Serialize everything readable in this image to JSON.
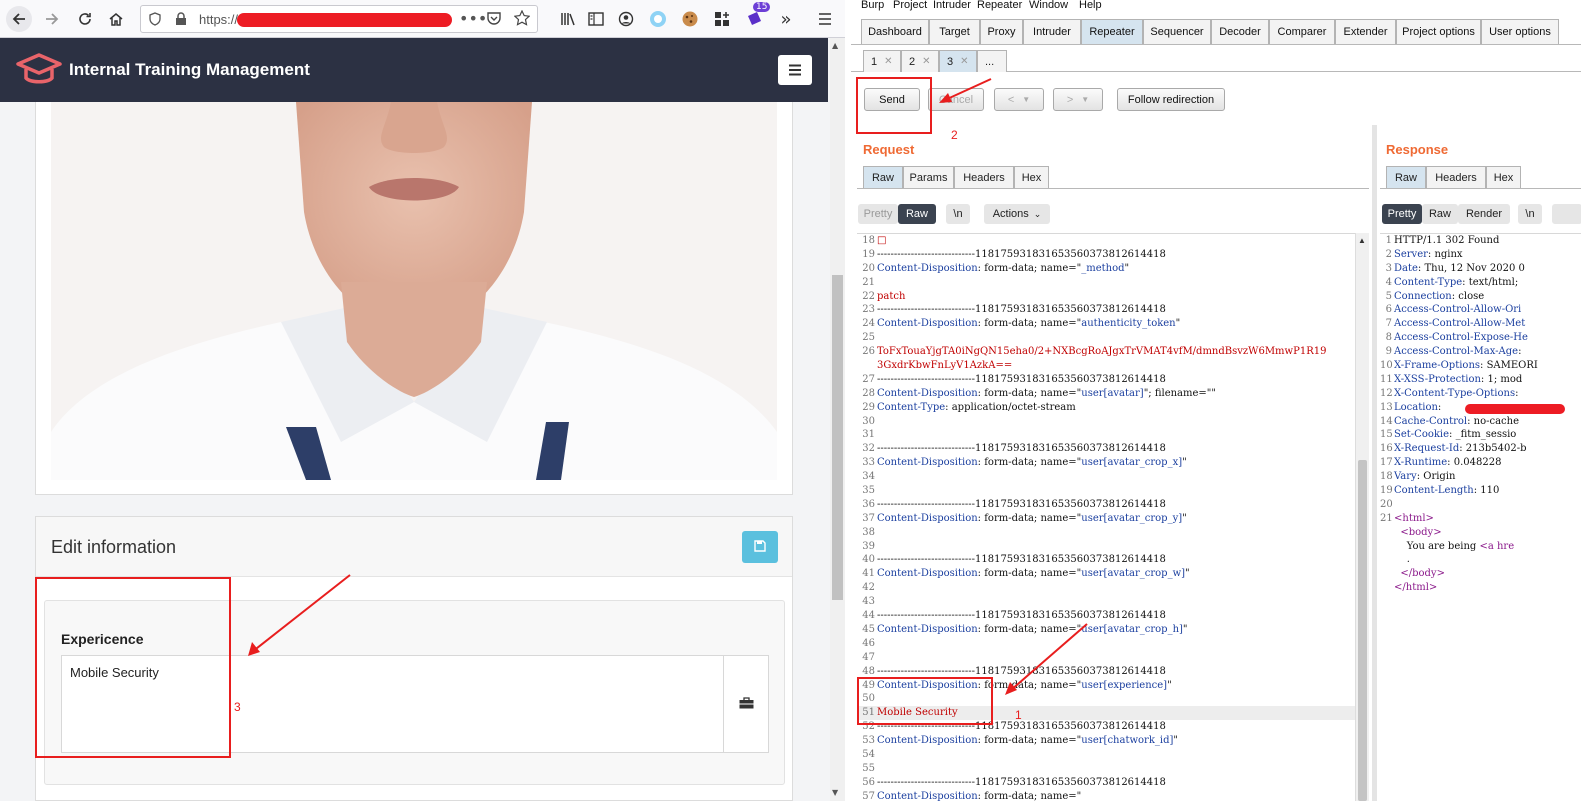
{
  "browser": {
    "url_prefix": "https://",
    "extension_badge": "15"
  },
  "app": {
    "brand": "Internal Training Management"
  },
  "edit": {
    "title": "Edit information",
    "experience_label": "Expericence",
    "experience_value": "Mobile Security"
  },
  "burp": {
    "menu": [
      "Burp",
      "Project",
      "Intruder",
      "Repeater",
      "Window",
      "Help"
    ],
    "tabs": [
      "Dashboard",
      "Target",
      "Proxy",
      "Intruder",
      "Repeater",
      "Sequencer",
      "Decoder",
      "Comparer",
      "Extender",
      "Project options",
      "User options"
    ],
    "active_tab": "Repeater",
    "subtabs": [
      "1",
      "2",
      "3",
      "..."
    ],
    "buttons": {
      "send": "Send",
      "cancel": "Cancel",
      "back": "<",
      "forward": ">",
      "follow": "Follow redirection"
    },
    "request": {
      "title": "Request",
      "tabs": [
        "Raw",
        "Params",
        "Headers",
        "Hex"
      ],
      "view_buttons": [
        "Pretty",
        "Raw",
        "\\n",
        "Actions"
      ]
    },
    "response": {
      "title": "Response",
      "tabs": [
        "Raw",
        "Headers",
        "Hex"
      ],
      "view_buttons": [
        "Pretty",
        "Raw",
        "Render",
        "\\n"
      ]
    }
  },
  "request_lines": [
    {
      "n": "18",
      "text": "□",
      "cls": "r"
    },
    {
      "n": "19",
      "text": "-----------------------------118175931831653560373812614418"
    },
    {
      "n": "20",
      "key": "Content-Disposition",
      "rest": ": form-data; name=\"",
      "val": "_method",
      "end": "\""
    },
    {
      "n": "21",
      "text": ""
    },
    {
      "n": "22",
      "text": "patch",
      "cls": "r"
    },
    {
      "n": "23",
      "text": "-----------------------------118175931831653560373812614418"
    },
    {
      "n": "24",
      "key": "Content-Disposition",
      "rest": ": form-data; name=\"",
      "val": "authenticity_token",
      "end": "\""
    },
    {
      "n": "25",
      "text": ""
    },
    {
      "n": "26",
      "text": "ToFxTouaYjgTA0iNgQN15eha0/2+NXBcgRoAJgxTrVMAT4vfM/dmndBsvzW6MmwP1R19",
      "cls": "r"
    },
    {
      "n": "",
      "text": "3GxdrKbwFnLyV1AzkA==",
      "cls": "r"
    },
    {
      "n": "27",
      "text": "-----------------------------118175931831653560373812614418"
    },
    {
      "n": "28",
      "key": "Content-Disposition",
      "rest": ": form-data; name=\"",
      "val": "user[avatar]",
      "end": "\"; filename=\"\""
    },
    {
      "n": "29",
      "key": "Content-Type",
      "rest": ": application/octet-stream",
      "val": "",
      "end": ""
    },
    {
      "n": "30",
      "text": ""
    },
    {
      "n": "31",
      "text": ""
    },
    {
      "n": "32",
      "text": "-----------------------------118175931831653560373812614418"
    },
    {
      "n": "33",
      "key": "Content-Disposition",
      "rest": ": form-data; name=\"",
      "val": "user[avatar_crop_x]",
      "end": "\""
    },
    {
      "n": "34",
      "text": ""
    },
    {
      "n": "35",
      "text": ""
    },
    {
      "n": "36",
      "text": "-----------------------------118175931831653560373812614418"
    },
    {
      "n": "37",
      "key": "Content-Disposition",
      "rest": ": form-data; name=\"",
      "val": "user[avatar_crop_y]",
      "end": "\""
    },
    {
      "n": "38",
      "text": ""
    },
    {
      "n": "39",
      "text": ""
    },
    {
      "n": "40",
      "text": "-----------------------------118175931831653560373812614418"
    },
    {
      "n": "41",
      "key": "Content-Disposition",
      "rest": ": form-data; name=\"",
      "val": "user[avatar_crop_w]",
      "end": "\""
    },
    {
      "n": "42",
      "text": ""
    },
    {
      "n": "43",
      "text": ""
    },
    {
      "n": "44",
      "text": "-----------------------------118175931831653560373812614418"
    },
    {
      "n": "45",
      "key": "Content-Disposition",
      "rest": ": form-data; name=\"",
      "val": "user[avatar_crop_h]",
      "end": "\""
    },
    {
      "n": "46",
      "text": ""
    },
    {
      "n": "47",
      "text": ""
    },
    {
      "n": "48",
      "text": "-----------------------------118175931831653560373812614418"
    },
    {
      "n": "49",
      "key": "Content-Disposition",
      "rest": ": form-data; name=\"",
      "val": "user[experience]",
      "end": "\""
    },
    {
      "n": "50",
      "text": ""
    },
    {
      "n": "51",
      "text": "Mobile Security",
      "cls": "r",
      "hl": true
    },
    {
      "n": "52",
      "text": "-----------------------------118175931831653560373812614418"
    },
    {
      "n": "53",
      "key": "Content-Disposition",
      "rest": ": form-data; name=\"",
      "val": "user[chatwork_id]",
      "end": "\""
    },
    {
      "n": "54",
      "text": ""
    },
    {
      "n": "55",
      "text": ""
    },
    {
      "n": "56",
      "text": "-----------------------------118175931831653560373812614418"
    },
    {
      "n": "57",
      "key": "Content-Disposition",
      "rest": ": form-data; name=\"",
      "val": "",
      "end": ""
    }
  ],
  "response_lines": [
    {
      "n": "1",
      "text": "HTTP/1.1 302 Found"
    },
    {
      "n": "2",
      "key": "Server",
      "rest": ": nginx"
    },
    {
      "n": "3",
      "key": "Date",
      "rest": ": Thu, 12 Nov 2020 0"
    },
    {
      "n": "4",
      "key": "Content-Type",
      "rest": ": text/html;"
    },
    {
      "n": "5",
      "key": "Connection",
      "rest": ": close"
    },
    {
      "n": "6",
      "key": "Access-Control-Allow-Ori",
      "rest": ""
    },
    {
      "n": "7",
      "key": "Access-Control-Allow-Met",
      "rest": ""
    },
    {
      "n": "8",
      "key": "Access-Control-Expose-He",
      "rest": ""
    },
    {
      "n": "9",
      "key": "Access-Control-Max-Age",
      "rest": ":"
    },
    {
      "n": "10",
      "key": "X-Frame-Options",
      "rest": ": SAMEORI"
    },
    {
      "n": "11",
      "key": "X-XSS-Protection",
      "rest": ": 1; mod"
    },
    {
      "n": "12",
      "key": "X-Content-Type-Options",
      "rest": ":"
    },
    {
      "n": "13",
      "key": "Location",
      "rest": ":"
    },
    {
      "n": "14",
      "key": "Cache-Control",
      "rest": ": no-cache"
    },
    {
      "n": "15",
      "key": "Set-Cookie",
      "rest": ": _fitm_sessio"
    },
    {
      "n": "16",
      "key": "X-Request-Id",
      "rest": ": 213b5402-b"
    },
    {
      "n": "17",
      "key": "X-Runtime",
      "rest": ": 0.048228"
    },
    {
      "n": "18",
      "key": "Vary",
      "rest": ": Origin"
    },
    {
      "n": "19",
      "key": "Content-Length",
      "rest": ": 110"
    },
    {
      "n": "20",
      "text": ""
    },
    {
      "n": "21",
      "tag": "<html>"
    },
    {
      "n": "",
      "tag": "  <body>"
    },
    {
      "n": "",
      "text": "    You are being ",
      "tagtail": "<a hre"
    },
    {
      "n": "",
      "text": "    ."
    },
    {
      "n": "",
      "tag": "  </body>"
    },
    {
      "n": "",
      "tag": "</html>"
    }
  ],
  "annotations": {
    "one": "1",
    "two": "2",
    "three": "3"
  }
}
